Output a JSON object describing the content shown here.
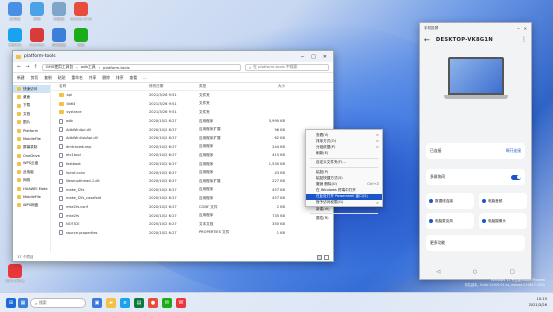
{
  "desktop": {
    "icons": [
      {
        "label": "此电脑",
        "color": "#4a8fe6"
      },
      {
        "label": "网络",
        "color": "#4aa3e6"
      },
      {
        "label": "回收站",
        "color": "#7fa6c9"
      },
      {
        "label": "Google Chrome",
        "color": "#e84c3d"
      },
      {
        "label": "腾讯QQ",
        "color": "#1aa2ef"
      },
      {
        "label": "Anyview",
        "color": "#d93b3b"
      },
      {
        "label": "控制面板",
        "color": "#3b7fd9"
      },
      {
        "label": "微信",
        "color": "#1aad19"
      },
      {
        "label": "WPS Office",
        "color": "#e8383d"
      }
    ]
  },
  "explorer": {
    "title": "platform-tools",
    "breadcrumb": [
      "GMS使用工具包",
      "adb工具",
      "platform-tools"
    ],
    "search_placeholder": "在 platform-tools 中搜索",
    "toolbar": [
      "新建",
      "剪切",
      "复制",
      "粘贴",
      "重命名",
      "共享",
      "删除",
      "排序",
      "查看",
      "..."
    ],
    "columns": [
      "名称",
      "修改日期",
      "类型",
      "大小"
    ],
    "sidebar": [
      {
        "label": "快速访问"
      },
      {
        "label": "桌面"
      },
      {
        "label": "下载"
      },
      {
        "label": "文档"
      },
      {
        "label": "图片"
      },
      {
        "label": "Platform"
      },
      {
        "label": "MobileFile"
      },
      {
        "label": "屏幕录制"
      },
      {
        "label": "OneDrive"
      },
      {
        "label": "WPS云盘"
      },
      {
        "label": "此电脑"
      },
      {
        "label": "网络"
      },
      {
        "label": "HUAWEI Mate"
      },
      {
        "label": "MobileFile"
      },
      {
        "label": "WPS网盘"
      }
    ],
    "files": [
      {
        "name": "api",
        "date": "2021/3/26 9:51",
        "type": "文件夹",
        "size": "",
        "kind": "folder"
      },
      {
        "name": "lib64",
        "date": "2021/3/26 9:51",
        "type": "文件夹",
        "size": "",
        "kind": "folder"
      },
      {
        "name": "systrace",
        "date": "2021/3/26 9:51",
        "type": "文件夹",
        "size": "",
        "kind": "folder"
      },
      {
        "name": "adb",
        "date": "2020/10/2 6:27",
        "type": "应用程序",
        "size": "5,990 KB",
        "kind": "file"
      },
      {
        "name": "AdbWinApi.dll",
        "date": "2020/10/2 6:27",
        "type": "应用程序扩展",
        "size": "96 KB",
        "kind": "file"
      },
      {
        "name": "AdbWinUsbApi.dll",
        "date": "2020/10/2 6:27",
        "type": "应用程序扩展",
        "size": "62 KB",
        "kind": "file"
      },
      {
        "name": "dmtracedump",
        "date": "2020/10/2 6:27",
        "type": "应用程序",
        "size": "244 KB",
        "kind": "file"
      },
      {
        "name": "etc1tool",
        "date": "2020/10/2 6:27",
        "type": "应用程序",
        "size": "415 KB",
        "kind": "file"
      },
      {
        "name": "fastboot",
        "date": "2020/10/2 6:27",
        "type": "应用程序",
        "size": "1,530 KB",
        "kind": "file"
      },
      {
        "name": "hprof-conv",
        "date": "2020/10/2 6:27",
        "type": "应用程序",
        "size": "43 KB",
        "kind": "file"
      },
      {
        "name": "libwinpthread-1.dll",
        "date": "2020/10/2 6:27",
        "type": "应用程序扩展",
        "size": "227 KB",
        "kind": "file"
      },
      {
        "name": "make_f2fs",
        "date": "2020/10/2 6:27",
        "type": "应用程序",
        "size": "457 KB",
        "kind": "file"
      },
      {
        "name": "make_f2fs_casefold",
        "date": "2020/10/2 6:27",
        "type": "应用程序",
        "size": "457 KB",
        "kind": "file"
      },
      {
        "name": "mke2fs.conf",
        "date": "2020/10/2 6:27",
        "type": "CONF 文件",
        "size": "2 KB",
        "kind": "file"
      },
      {
        "name": "mke2fs",
        "date": "2020/10/2 6:27",
        "type": "应用程序",
        "size": "735 KB",
        "kind": "file"
      },
      {
        "name": "NOTICE",
        "date": "2020/10/2 6:27",
        "type": "文本文档",
        "size": "350 KB",
        "kind": "file"
      },
      {
        "name": "source.properties",
        "date": "2020/10/2 6:27",
        "type": "PROPERTIES 文件",
        "size": "1 KB",
        "kind": "file"
      }
    ],
    "status": "17 个项目"
  },
  "context_menu": {
    "items": [
      {
        "label": "查看(V)",
        "key": ">"
      },
      {
        "label": "排序方式(O)",
        "key": ">"
      },
      {
        "label": "分组依据(P)",
        "key": ">"
      },
      {
        "label": "刷新(E)",
        "key": ""
      },
      {
        "sep": true
      },
      {
        "label": "自定义文件夹(F)...",
        "key": ""
      },
      {
        "sep": true
      },
      {
        "label": "粘贴(P)",
        "key": ""
      },
      {
        "label": "粘贴快捷方式(S)",
        "key": ""
      },
      {
        "label": "撤销 删除(U)",
        "key": "Ctrl+Z"
      },
      {
        "label": "在 Windows 终端中打开",
        "key": ""
      },
      {
        "label": "在此处打开 Powershell 窗口(S)",
        "key": "",
        "highlight": true
      },
      {
        "label": "授予访问权限(G)",
        "key": ">"
      },
      {
        "label": "新建(W)",
        "key": ">"
      },
      {
        "sep": true
      },
      {
        "label": "属性(R)",
        "key": ""
      }
    ]
  },
  "phone": {
    "window_title": "手机投屏",
    "device_name": "DESKTOP-VK8G1N",
    "connected_label": "已连接",
    "connected_value": "断开连接",
    "toggle_label": "多屏协同",
    "tiles": [
      "数据线连接",
      "电脑音频",
      "电脑麦克风",
      "电脑摄像头"
    ],
    "more_label": "更多功能"
  },
  "taskbar": {
    "search_placeholder": "搜索",
    "time": "10:15",
    "date": "2021/3/26"
  },
  "watermark": {
    "line1": "Windows 11 专业版Insider Preview",
    "line2": "评估副本。Build 22000.51.co_release.210617-2050"
  }
}
